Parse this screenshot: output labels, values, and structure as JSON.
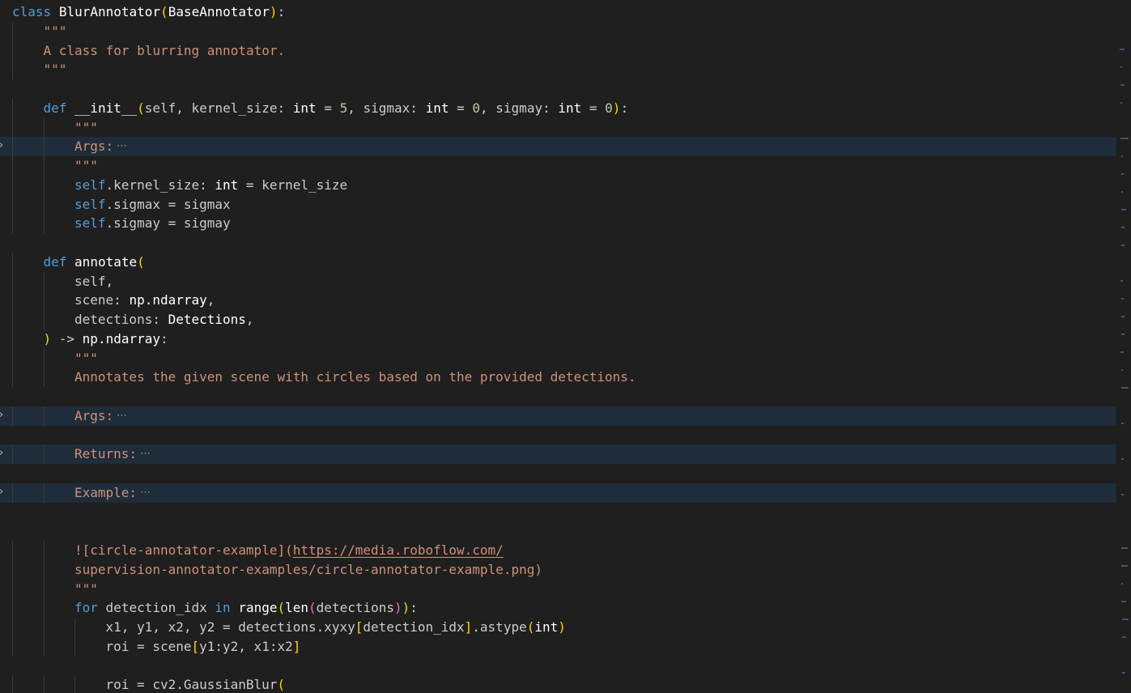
{
  "editor": {
    "colors": {
      "background": "#1f1f1f",
      "folded_line_highlight": "#1f2c3a",
      "keyword": "#569cd6",
      "string": "#ce9178",
      "number": "#b5cea8",
      "bracket_level1": "#ffd700",
      "bracket_level2": "#da70d6",
      "bracket_level3": "#179fff"
    },
    "fold_icon": "chevron-right-icon",
    "lines": [
      {
        "indent": 0,
        "tokens": [
          [
            "class",
            "t-kw"
          ],
          [
            " ",
            "t-default"
          ],
          [
            "BlurAnnotator",
            "t-cls"
          ],
          [
            "(",
            "t-b1"
          ],
          [
            "BaseAnnotator",
            "t-cls"
          ],
          [
            ")",
            "t-b1"
          ],
          [
            ":",
            "t-default"
          ]
        ]
      },
      {
        "indent": 1,
        "tokens": [
          [
            "\"\"\"",
            "t-doc"
          ]
        ]
      },
      {
        "indent": 1,
        "tokens": [
          [
            "A class for blurring annotator.",
            "t-doc"
          ]
        ]
      },
      {
        "indent": 1,
        "tokens": [
          [
            "\"\"\"",
            "t-doc"
          ]
        ]
      },
      {
        "indent": 0,
        "tokens": []
      },
      {
        "indent": 1,
        "tokens": [
          [
            "def",
            "t-kw"
          ],
          [
            " ",
            "t-default"
          ],
          [
            "__init__",
            "t-fn"
          ],
          [
            "(",
            "t-b1"
          ],
          [
            "self",
            "t-param"
          ],
          [
            ", ",
            "t-default"
          ],
          [
            "kernel_size",
            "t-param"
          ],
          [
            ": ",
            "t-default"
          ],
          [
            "int",
            "t-cls"
          ],
          [
            " = ",
            "t-op"
          ],
          [
            "5",
            "t-num"
          ],
          [
            ", ",
            "t-default"
          ],
          [
            "sigmax",
            "t-param"
          ],
          [
            ": ",
            "t-default"
          ],
          [
            "int",
            "t-cls"
          ],
          [
            " = ",
            "t-op"
          ],
          [
            "0",
            "t-num"
          ],
          [
            ", ",
            "t-default"
          ],
          [
            "sigmay",
            "t-param"
          ],
          [
            ": ",
            "t-default"
          ],
          [
            "int",
            "t-cls"
          ],
          [
            " = ",
            "t-op"
          ],
          [
            "0",
            "t-num"
          ],
          [
            ")",
            "t-b1"
          ],
          [
            ":",
            "t-default"
          ]
        ]
      },
      {
        "indent": 2,
        "tokens": [
          [
            "\"\"\"",
            "t-doc"
          ]
        ]
      },
      {
        "indent": 2,
        "folded": true,
        "tokens": [
          [
            "Args:",
            "t-doc"
          ]
        ]
      },
      {
        "indent": 2,
        "tokens": [
          [
            "\"\"\"",
            "t-doc"
          ]
        ]
      },
      {
        "indent": 2,
        "tokens": [
          [
            "self",
            "t-self"
          ],
          [
            ".kernel_size",
            "t-default"
          ],
          [
            ": ",
            "t-default"
          ],
          [
            "int",
            "t-cls"
          ],
          [
            " = ",
            "t-op"
          ],
          [
            "kernel_size",
            "t-param"
          ]
        ]
      },
      {
        "indent": 2,
        "tokens": [
          [
            "self",
            "t-self"
          ],
          [
            ".sigmax",
            "t-default"
          ],
          [
            " = ",
            "t-op"
          ],
          [
            "sigmax",
            "t-param"
          ]
        ]
      },
      {
        "indent": 2,
        "tokens": [
          [
            "self",
            "t-self"
          ],
          [
            ".sigmay",
            "t-default"
          ],
          [
            " = ",
            "t-op"
          ],
          [
            "sigmay",
            "t-param"
          ]
        ]
      },
      {
        "indent": 0,
        "tokens": []
      },
      {
        "indent": 1,
        "tokens": [
          [
            "def",
            "t-kw"
          ],
          [
            " ",
            "t-default"
          ],
          [
            "annotate",
            "t-fn"
          ],
          [
            "(",
            "t-b1"
          ]
        ]
      },
      {
        "indent": 2,
        "tokens": [
          [
            "self",
            "t-param"
          ],
          [
            ",",
            "t-default"
          ]
        ]
      },
      {
        "indent": 2,
        "tokens": [
          [
            "scene",
            "t-param"
          ],
          [
            ": ",
            "t-default"
          ],
          [
            "np.ndarray",
            "t-cls"
          ],
          [
            ",",
            "t-default"
          ]
        ]
      },
      {
        "indent": 2,
        "tokens": [
          [
            "detections",
            "t-param"
          ],
          [
            ": ",
            "t-default"
          ],
          [
            "Detections",
            "t-cls"
          ],
          [
            ",",
            "t-default"
          ]
        ]
      },
      {
        "indent": 1,
        "tokens": [
          [
            ")",
            "t-b1"
          ],
          [
            " -> ",
            "t-op"
          ],
          [
            "np.ndarray",
            "t-cls"
          ],
          [
            ":",
            "t-default"
          ]
        ]
      },
      {
        "indent": 2,
        "tokens": [
          [
            "\"\"\"",
            "t-doc"
          ]
        ]
      },
      {
        "indent": 2,
        "tokens": [
          [
            "Annotates the given scene with circles based on the provided detections.",
            "t-doc"
          ]
        ]
      },
      {
        "indent": 0,
        "tokens": []
      },
      {
        "indent": 2,
        "folded": true,
        "tokens": [
          [
            "Args:",
            "t-doc"
          ]
        ]
      },
      {
        "indent": 0,
        "tokens": []
      },
      {
        "indent": 2,
        "folded": true,
        "tokens": [
          [
            "Returns:",
            "t-doc"
          ]
        ]
      },
      {
        "indent": 0,
        "tokens": []
      },
      {
        "indent": 2,
        "folded": true,
        "tokens": [
          [
            "Example:",
            "t-doc"
          ]
        ]
      },
      {
        "indent": 0,
        "tokens": []
      },
      {
        "indent": 0,
        "tokens": []
      },
      {
        "indent": 2,
        "tokens": [
          [
            "![circle-annotator-example](",
            "t-doc"
          ],
          [
            "https://media.roboflow.com/",
            "t-link"
          ]
        ]
      },
      {
        "indent": 2,
        "tokens": [
          [
            "supervision-annotator-examples/circle-annotator-example.png",
            "t-doc"
          ],
          [
            ")",
            "t-doc"
          ]
        ]
      },
      {
        "indent": 2,
        "tokens": [
          [
            "\"\"\"",
            "t-doc"
          ]
        ]
      },
      {
        "indent": 2,
        "tokens": [
          [
            "for",
            "t-ctrl"
          ],
          [
            " detection_idx ",
            "t-default"
          ],
          [
            "in",
            "t-ctrl"
          ],
          [
            " ",
            "t-default"
          ],
          [
            "range",
            "t-fn"
          ],
          [
            "(",
            "t-b1"
          ],
          [
            "len",
            "t-fn"
          ],
          [
            "(",
            "t-b2"
          ],
          [
            "detections",
            "t-default"
          ],
          [
            ")",
            "t-b2"
          ],
          [
            ")",
            "t-b1"
          ],
          [
            ":",
            "t-default"
          ]
        ]
      },
      {
        "indent": 3,
        "tokens": [
          [
            "x1, y1, x2, y2",
            "t-default"
          ],
          [
            " = ",
            "t-op"
          ],
          [
            "detections.xyxy",
            "t-default"
          ],
          [
            "[",
            "t-b1"
          ],
          [
            "detection_idx",
            "t-default"
          ],
          [
            "]",
            "t-b1"
          ],
          [
            ".astype",
            "t-default"
          ],
          [
            "(",
            "t-b1"
          ],
          [
            "int",
            "t-cls"
          ],
          [
            ")",
            "t-b1"
          ]
        ]
      },
      {
        "indent": 3,
        "tokens": [
          [
            "roi",
            "t-default"
          ],
          [
            " = ",
            "t-op"
          ],
          [
            "scene",
            "t-default"
          ],
          [
            "[",
            "t-b1"
          ],
          [
            "y1:y2, x1:x2",
            "t-default"
          ],
          [
            "]",
            "t-b1"
          ]
        ]
      },
      {
        "indent": 0,
        "tokens": []
      },
      {
        "indent": 3,
        "tokens": [
          [
            "roi",
            "t-default"
          ],
          [
            " = ",
            "t-op"
          ],
          [
            "cv2.GaussianBlur",
            "t-default"
          ],
          [
            "(",
            "t-b1"
          ]
        ]
      }
    ]
  }
}
